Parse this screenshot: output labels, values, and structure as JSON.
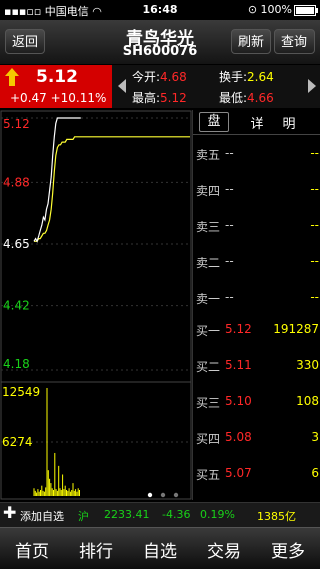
{
  "status": {
    "carrier": "中国电信",
    "time": "16:48",
    "battery": "100%"
  },
  "nav": {
    "back": "返回",
    "name": "青鸟华光",
    "code": "SH600076",
    "refresh": "刷新",
    "query": "查询"
  },
  "quote": {
    "price": "5.12",
    "change": "+0.47 +10.11%"
  },
  "stats": {
    "open_label": "今开:",
    "open": "4.68",
    "turnover_label": "换手:",
    "turnover": "2.64",
    "high_label": "最高:",
    "high": "5.12",
    "low_label": "最低:",
    "low": "4.66"
  },
  "colors": {
    "up": "#ff2828",
    "down": "#19d219",
    "line": "#ffff33",
    "accent": "#d40000"
  },
  "chart_data": {
    "type": "line",
    "y_tick_labels": [
      "5.12",
      "4.88",
      "4.65",
      "4.42",
      "4.18"
    ],
    "volume_tick_labels": [
      "12549",
      "6274"
    ],
    "ylim": [
      4.18,
      5.12
    ],
    "volume_max": 12549,
    "series": [
      {
        "name": "",
        "values": [
          4.66,
          4.67,
          4.66,
          4.68,
          4.7,
          4.72,
          4.75,
          4.74,
          4.78,
          4.8,
          4.85,
          4.9,
          4.98,
          5.05,
          5.1,
          5.12,
          5.12,
          5.12,
          5.12,
          5.12,
          5.12,
          5.12,
          5.12,
          5.12,
          5.12,
          5.12,
          5.12,
          5.12,
          5.12,
          5.12
        ]
      },
      {
        "name": "",
        "values": [
          4.66,
          4.66,
          4.66,
          4.67,
          4.67,
          4.68,
          4.69,
          4.69,
          4.7,
          4.72,
          4.74,
          4.78,
          4.84,
          4.92,
          4.98,
          5.01,
          5.02,
          5.02,
          5.03,
          5.03,
          5.03,
          5.04,
          5.04,
          5.04,
          5.04,
          5.04,
          5.05,
          5.05,
          5.05,
          5.05
        ]
      }
    ],
    "volume": [
      900,
      600,
      400,
      800,
      500,
      700,
      1200,
      600,
      500,
      1000,
      12549,
      3000,
      2000,
      1500,
      900,
      700,
      5000,
      800,
      600,
      3500,
      900,
      700,
      2500,
      800,
      1200,
      700,
      600,
      900,
      500,
      700,
      1500,
      600,
      800,
      500,
      900,
      700
    ]
  },
  "panel": {
    "tabs": [
      "盘",
      "详",
      "明"
    ],
    "asks": [
      {
        "label": "卖五",
        "price": "--",
        "vol": "--"
      },
      {
        "label": "卖四",
        "price": "--",
        "vol": "--"
      },
      {
        "label": "卖三",
        "price": "--",
        "vol": "--"
      },
      {
        "label": "卖二",
        "price": "--",
        "vol": "--"
      },
      {
        "label": "卖一",
        "price": "--",
        "vol": "--"
      }
    ],
    "bids": [
      {
        "label": "买一",
        "price": "5.12",
        "vol": "191287"
      },
      {
        "label": "买二",
        "price": "5.11",
        "vol": "330"
      },
      {
        "label": "买三",
        "price": "5.10",
        "vol": "108"
      },
      {
        "label": "买四",
        "price": "5.08",
        "vol": "3"
      },
      {
        "label": "买五",
        "price": "5.07",
        "vol": "6"
      }
    ]
  },
  "footer": {
    "add_label": "添加自选",
    "market": "沪",
    "index": "2233.41",
    "index_change": "-4.36",
    "index_pct": "0.19%",
    "amount": "1385亿"
  },
  "tabbar": [
    "首页",
    "排行",
    "自选",
    "交易",
    "更多"
  ]
}
